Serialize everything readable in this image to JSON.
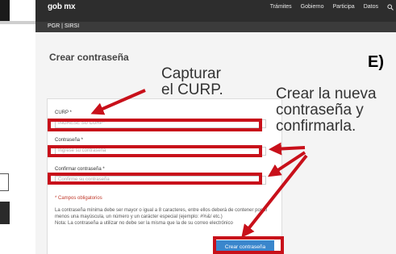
{
  "header": {
    "logo": "gob mx",
    "nav": [
      "Trámites",
      "Gobierno",
      "Participa",
      "Datos"
    ],
    "search_icon": "search-icon",
    "subtitle": "PGR | SIRSI"
  },
  "page": {
    "title": "Crear contraseña"
  },
  "form": {
    "curp_label": "CURP *",
    "curp_placeholder": "INGRESE SU CURP*",
    "password_label": "Contraseña *",
    "password_placeholder": "Ingrese su contraseña",
    "confirm_label": "Confirmar contraseña *",
    "confirm_placeholder": "Confirme su contraseña",
    "required_note": "* Campos obligatorios",
    "rules_note": "La contraseña mínima debe ser mayor o igual a 8 caracteres, entre ellos deberá de contener por lo menos una mayúscula, un número y un carácter especial (ejemplo: #%&/ etc.)",
    "rules_note_2": "Nota: La contraseña a utilizar no debe ser la misma que la de su correo electrónico",
    "submit_label": "Crear contraseña"
  },
  "annotations": {
    "step_letter": "E)",
    "capture_curp": [
      "Capturar",
      "el CURP."
    ],
    "create_password": [
      "Crear la nueva",
      "contraseña y",
      "confirmarla."
    ],
    "highlight_color": "#c8101a"
  }
}
